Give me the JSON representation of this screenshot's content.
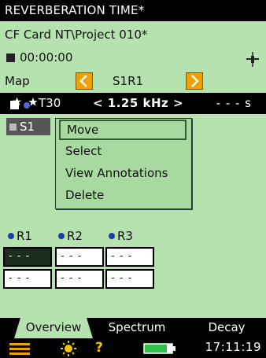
{
  "title": "REVERBERATION TIME*",
  "path": "CF Card NT\\Project 010*",
  "timer": "00:00:00",
  "nav": {
    "label": "Map",
    "position": "S1R1"
  },
  "params": {
    "parameter": "T30",
    "frequency": "< 1.25 kHz >",
    "value": "- - - s"
  },
  "source_chip": "S1",
  "context_menu": [
    "Move",
    "Select",
    "View Annotations",
    "Delete"
  ],
  "positions": [
    "R1",
    "R2",
    "R3"
  ],
  "grid": [
    [
      "- - -",
      "- - -",
      "- - -"
    ],
    [
      "- - -",
      "- - -",
      "- - -"
    ]
  ],
  "tabs": [
    "Overview",
    "Spectrum",
    "Decay"
  ],
  "active_tab": "Overview",
  "clock": "17:11:19",
  "colors": {
    "background": "#b6e2b0",
    "bar": "#000000",
    "accent": "#f0a000",
    "dot": "#1a3fa8"
  },
  "icons": [
    "satellite-icon",
    "arrow-left-icon",
    "arrow-right-icon",
    "sparkle-icon",
    "menu-icon",
    "light-icon",
    "help-icon",
    "battery-icon"
  ]
}
